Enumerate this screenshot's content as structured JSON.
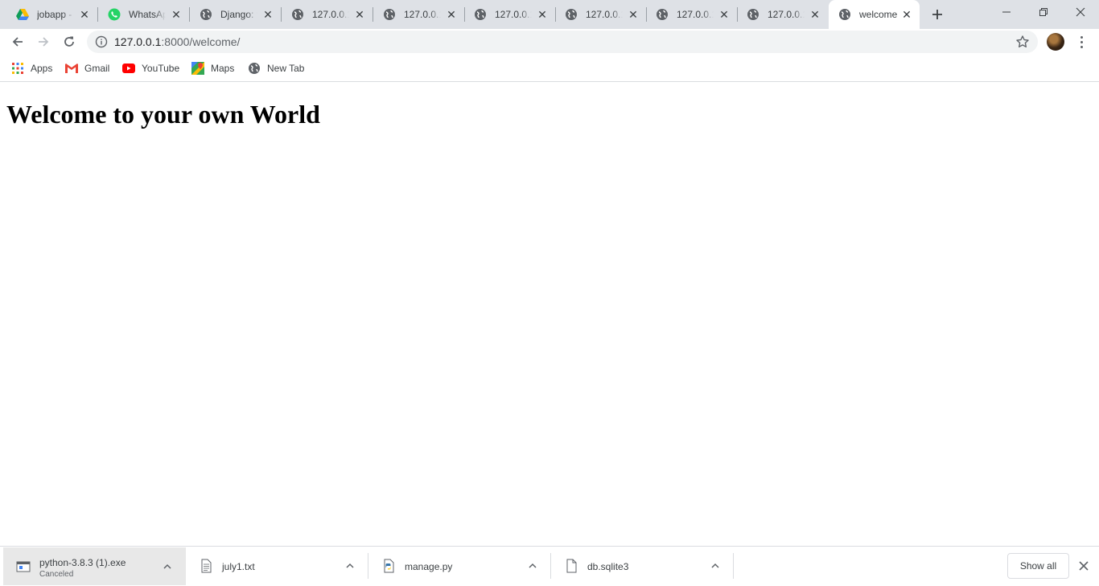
{
  "tabs": [
    {
      "title": "jobapp - ",
      "icon": "google-drive-icon"
    },
    {
      "title": "WhatsApp",
      "icon": "whatsapp-icon"
    },
    {
      "title": "Django: t",
      "icon": "globe-icon"
    },
    {
      "title": "127.0.0.1:",
      "icon": "globe-icon"
    },
    {
      "title": "127.0.0.1:",
      "icon": "globe-icon"
    },
    {
      "title": "127.0.0.1:",
      "icon": "globe-icon"
    },
    {
      "title": "127.0.0.1:",
      "icon": "globe-icon"
    },
    {
      "title": "127.0.0.1:",
      "icon": "globe-icon"
    },
    {
      "title": "127.0.0.1:",
      "icon": "globe-icon"
    },
    {
      "title": "welcome",
      "icon": "globe-icon",
      "active": true
    }
  ],
  "address": {
    "host": "127.0.0.1",
    "path": ":8000/welcome/"
  },
  "bookmarks": [
    {
      "label": "Apps",
      "icon": "apps-grid-icon"
    },
    {
      "label": "Gmail",
      "icon": "gmail-icon"
    },
    {
      "label": "YouTube",
      "icon": "youtube-icon"
    },
    {
      "label": "Maps",
      "icon": "maps-icon"
    },
    {
      "label": "New Tab",
      "icon": "globe-icon"
    }
  ],
  "page": {
    "heading": "Welcome to your own World"
  },
  "downloads": [
    {
      "name": "python-3.8.3 (1).exe",
      "status": "Canceled",
      "icon": "installer-icon"
    },
    {
      "name": "july1.txt",
      "status": "",
      "icon": "text-file-icon"
    },
    {
      "name": "manage.py",
      "status": "",
      "icon": "python-file-icon"
    },
    {
      "name": "db.sqlite3",
      "status": "",
      "icon": "file-icon"
    }
  ],
  "shelf": {
    "show_all_label": "Show all"
  },
  "colors": {
    "tabstrip_bg": "#dee1e6",
    "omnibox_bg": "#f1f3f4",
    "text": "#3c4043"
  }
}
